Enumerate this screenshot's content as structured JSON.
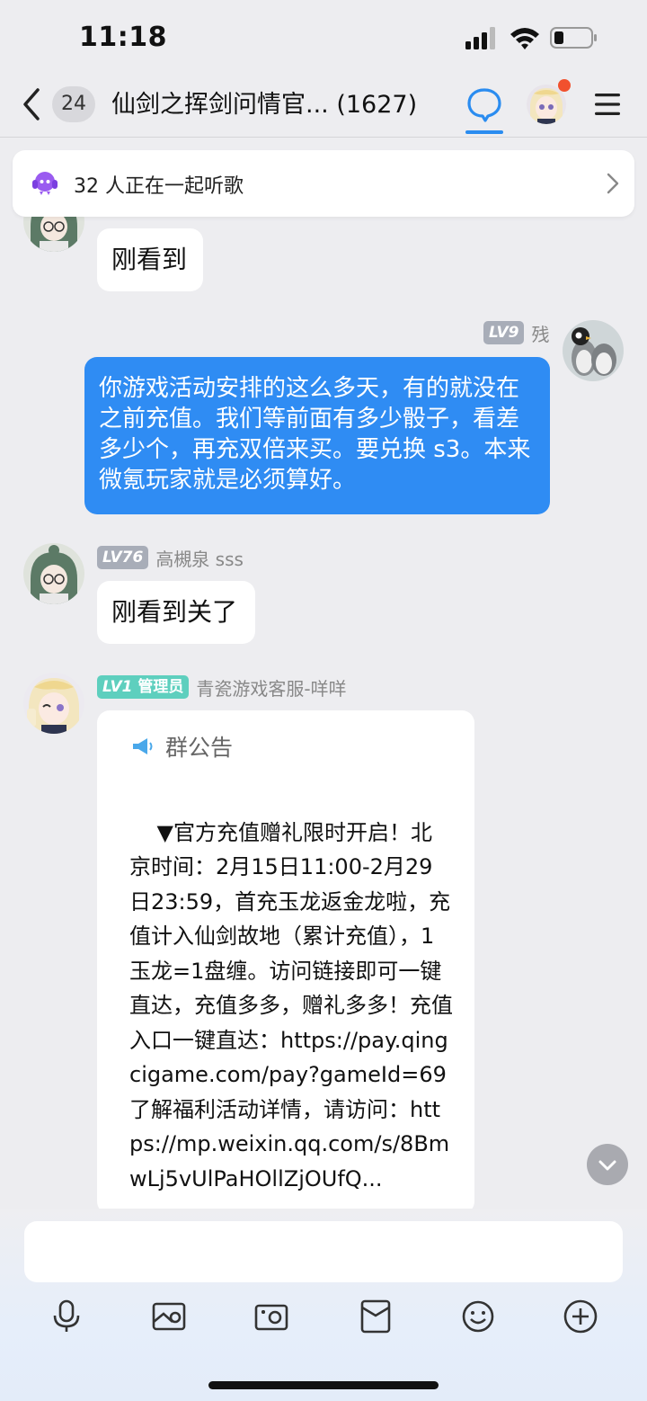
{
  "status_bar": {
    "time": "11:18"
  },
  "nav": {
    "unread_count": "24",
    "title": "仙剑之挥剑问情官... (1627)"
  },
  "banner": {
    "text": "32 人正在一起听歌"
  },
  "messages": [
    {
      "text": "刚看到"
    },
    {
      "level": "LV9",
      "name": "残",
      "text": "你游戏活动安排的这么多天，有的就没在之前充值。我们等前面有多少骰子，看差多少个，再充双倍来买。要兑换 s3。本来微氪玩家就是必须算好。"
    },
    {
      "level": "LV76",
      "name": "高槻泉 sss",
      "text": "刚看到关了"
    },
    {
      "level": "LV1",
      "role": "管理员",
      "name": "青瓷游戏客服-咩咩"
    }
  ],
  "notice": {
    "title": "群公告",
    "body": "▼官方充值赠礼限时开启！北京时间：2月15日11:00-2月29日23:59，首充玉龙返金龙啦，充值计入仙剑故地（累计充值），1玉龙=1盘缠。访问链接即可一键直达，充值多多，赠礼多多！充值入口一键直达：https://pay.qingcigame.com/pay?gameId=69\n了解福利活动详情，请访问：https://mp.weixin.qq.com/s/8BmwLj5vUlPaHOllZjOUfQ..."
  },
  "colors": {
    "accent": "#2f8cf3",
    "notification_dot": "#f1512e"
  }
}
